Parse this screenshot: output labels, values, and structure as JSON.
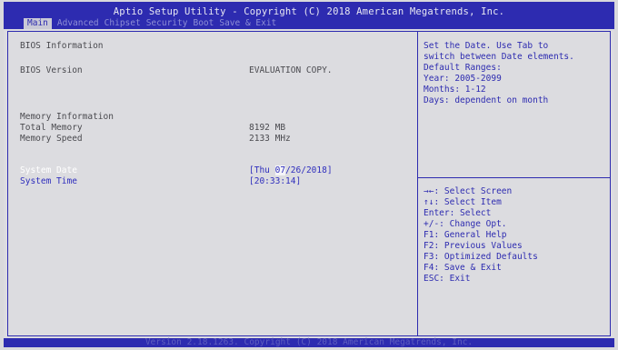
{
  "title": "Aptio Setup Utility - Copyright (C) 2018 American Megatrends, Inc.",
  "menu": [
    {
      "label": "Main",
      "active": true
    },
    {
      "label": "Advanced"
    },
    {
      "label": "Chipset"
    },
    {
      "label": "Security"
    },
    {
      "label": "Boot"
    },
    {
      "label": "Save & Exit"
    }
  ],
  "main": {
    "bios_info_header": "BIOS Information",
    "bios_version_label": "BIOS Version",
    "bios_version_value": "EVALUATION COPY.",
    "memory_info_header": "Memory Information",
    "total_memory_label": "Total Memory",
    "total_memory_value": "8192 MB",
    "memory_speed_label": "Memory Speed",
    "memory_speed_value": "2133 MHz",
    "system_date_label": "System Date",
    "system_date_prefix": "[Thu ",
    "system_date_month": "07",
    "system_date_suffix": "/26/2018]",
    "system_time_label": "System Time",
    "system_time_value": "[20:33:14]"
  },
  "help": {
    "lines": [
      "Set the Date. Use Tab to",
      "switch between Date elements.",
      "Default Ranges:",
      "Year: 2005-2099",
      "Months: 1-12",
      "Days: dependent on month"
    ]
  },
  "keys": {
    "lines": [
      "→←: Select Screen",
      "↑↓: Select Item",
      "Enter: Select",
      "+/-: Change Opt.",
      "F1: General Help",
      "F2: Previous Values",
      "F3: Optimized Defaults",
      "F4: Save & Exit",
      "ESC: Exit"
    ]
  },
  "footer": "Version 2.18.1263. Copyright (C) 2018 American Megatrends, Inc.",
  "colors": {
    "bar": "#2d2bb0",
    "background": "#dcdce0",
    "text": "#4a4a4f",
    "highlight": "#ffffff"
  }
}
